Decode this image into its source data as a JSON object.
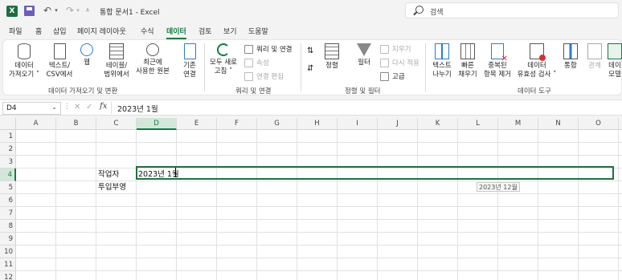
{
  "window": {
    "app_logo": "X",
    "doc_title": "통합 문서1 - Excel",
    "search_placeholder": "검색",
    "quick_access": [
      "save-icon",
      "undo-icon",
      "redo-icon",
      "customize-dropdown-icon"
    ]
  },
  "tabs": [
    {
      "label": "파일"
    },
    {
      "label": "홈"
    },
    {
      "label": "삽입"
    },
    {
      "label": "페이지 레이아웃"
    },
    {
      "label": "수식"
    },
    {
      "label": "데이터",
      "active": true
    },
    {
      "label": "검토"
    },
    {
      "label": "보기"
    },
    {
      "label": "도움말"
    }
  ],
  "ribbon": {
    "get_data": {
      "group_label": "데이터 가져오기 및 변환",
      "buttons": [
        {
          "label1": "데이터",
          "label2": "가져오기 ˅",
          "icon": "database-icon"
        },
        {
          "label1": "텍스트/",
          "label2": "CSV에서",
          "icon": "text-file-icon"
        },
        {
          "label1": "웹",
          "label2": "",
          "icon": "web-icon"
        },
        {
          "label1": "테이블/",
          "label2": "범위에서",
          "icon": "table-icon"
        },
        {
          "label1": "최근에",
          "label2": "사용한 원본",
          "icon": "recent-sources-icon"
        },
        {
          "label1": "기존",
          "label2": "연결",
          "icon": "existing-connections-icon"
        }
      ]
    },
    "queries": {
      "group_label": "쿼리 및 연결",
      "refresh_all": {
        "label1": "모두 새로",
        "label2": "고침 ˅"
      },
      "queries_connections": "쿼리 및 연결",
      "properties": "속성",
      "edit_links": "연결 편집"
    },
    "sort_filter": {
      "group_label": "정렬 및 필터",
      "sort": "정렬",
      "filter": "필터",
      "clear": "지우기",
      "reapply": "다시 적용",
      "advanced": "고급"
    },
    "data_tools": {
      "group_label": "데이터 도구",
      "buttons": [
        {
          "label1": "텍스트",
          "label2": "나누기"
        },
        {
          "label1": "빠른",
          "label2": "채우기"
        },
        {
          "label1": "중복된",
          "label2": "항목 제거"
        },
        {
          "label1": "데이터",
          "label2": "유효성 검사 ˅"
        },
        {
          "label1": "통합",
          "label2": ""
        },
        {
          "label1": "관계",
          "label2": ""
        },
        {
          "label1": "데이",
          "label2": "모델"
        }
      ]
    }
  },
  "formula_bar": {
    "name_box": "D4",
    "fx": "fx",
    "value": "2023년 1월"
  },
  "grid": {
    "columns": [
      "A",
      "B",
      "C",
      "D",
      "E",
      "F",
      "G",
      "H",
      "I",
      "J",
      "K",
      "L",
      "M",
      "N",
      "O"
    ],
    "rows": [
      "1",
      "2",
      "3",
      "4",
      "5",
      "6",
      "7",
      "8",
      "9",
      "10",
      "11",
      "12"
    ],
    "selected_column": "D",
    "selected_row": "4",
    "cells": {
      "C4": "작업자",
      "C5": "투입부영",
      "D4": "2023년 1월"
    },
    "autocomplete_tip": "2023년 12월"
  }
}
